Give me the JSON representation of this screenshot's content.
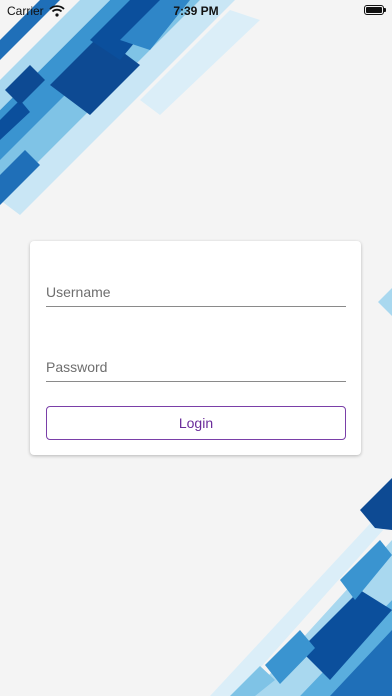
{
  "status_bar": {
    "carrier": "Carrier",
    "time": "7:39 PM",
    "wifi_icon": "wifi-icon",
    "battery_icon": "battery-icon"
  },
  "login_form": {
    "username_placeholder": "Username",
    "username_value": "",
    "password_placeholder": "Password",
    "password_value": "",
    "login_label": "Login"
  },
  "colors": {
    "background": "#f4f4f4",
    "accent": "#6a2c9a",
    "decor_dark_blue": "#0b4f9c",
    "decor_light_blue": "#a9d8ef"
  }
}
